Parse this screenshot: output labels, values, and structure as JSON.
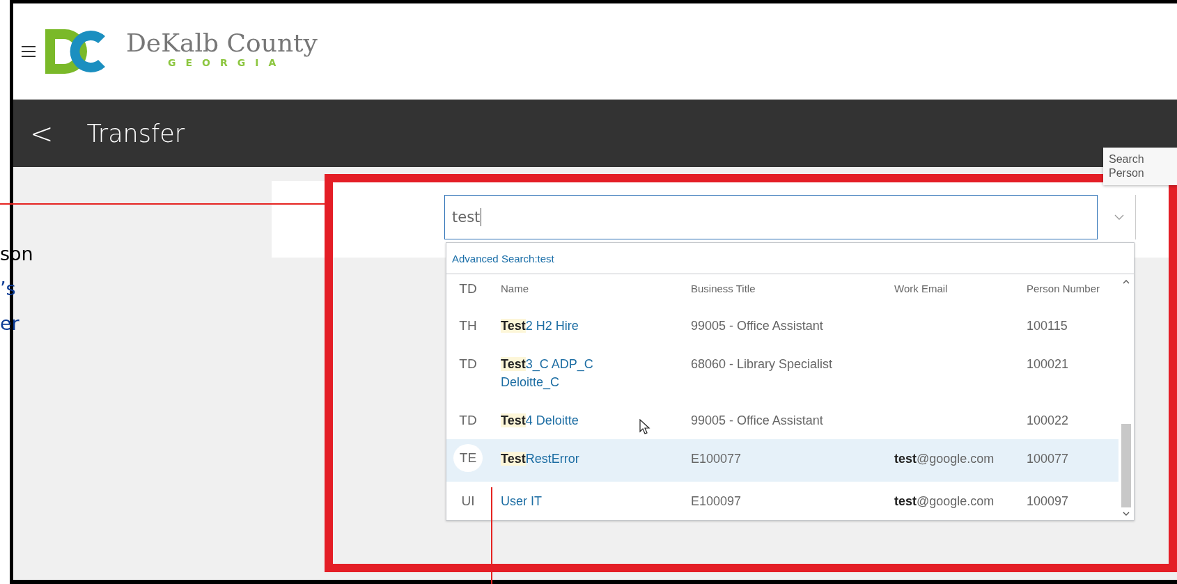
{
  "header": {
    "brand": "DeKalb County",
    "brand_sub": "GEORGIA"
  },
  "title_bar": {
    "back": "<",
    "title": "Transfer"
  },
  "side_text": [
    "son",
    "’s",
    "er"
  ],
  "tooltip": [
    "Search",
    "Person"
  ],
  "search": {
    "value": "test",
    "advanced": "Advanced Search:test"
  },
  "table": {
    "columns": [
      "TD",
      "Name",
      "Business Title",
      "Work Email",
      "Person Number"
    ],
    "rows": [
      {
        "initials": "TH",
        "name": "**Test**2 H2 Hire",
        "title": "99005 - Office Assistant",
        "email": "",
        "number": "100115",
        "selected": false
      },
      {
        "initials": "TD",
        "name": "**Test**3_C ADP_C Deloitte_C",
        "title": "68060 - Library Specialist",
        "email": "",
        "number": "100021",
        "selected": false
      },
      {
        "initials": "TD",
        "name": "**Test**4 Deloitte",
        "title": "99005 - Office Assistant",
        "email": "",
        "number": "100022",
        "selected": false
      },
      {
        "initials": "TE",
        "name": "**Test**RestError",
        "title": "E100077",
        "email": "**test**@google.com",
        "number": "100077",
        "selected": true
      },
      {
        "initials": "UI",
        "name": "User IT",
        "title": "E100097",
        "email": "**test**@google.com",
        "number": "100097",
        "selected": false
      }
    ]
  }
}
